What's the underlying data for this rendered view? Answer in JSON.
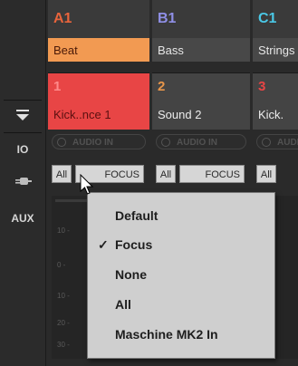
{
  "groups": [
    {
      "letter": "A1",
      "name": "Beat",
      "color": "#e8643c",
      "head_bg": "#f08a4a",
      "name_bg": "#f29a52",
      "name_color": "#4a1a08"
    },
    {
      "letter": "B1",
      "name": "Bass",
      "color": "#8f8fe6"
    },
    {
      "letter": "C1",
      "name": "Strings",
      "color": "#4ac8e6"
    }
  ],
  "sounds": [
    {
      "number": "1",
      "name": "Kick..nce 1",
      "color": "#ff6b6b",
      "bg": "#e84545",
      "name_color": "#5b1010"
    },
    {
      "number": "2",
      "name": "Sound 2",
      "color": "#e8964a"
    },
    {
      "number": "3",
      "name": "Kick.",
      "color": "#e84545"
    }
  ],
  "rail": {
    "io_label": "IO",
    "aux_label": "AUX"
  },
  "audio_in_label": "AUDIO IN",
  "focus_row": {
    "all_label": "All",
    "focus_label": "FOCUS"
  },
  "dropdown": {
    "items": [
      {
        "label": "Default",
        "checked": false
      },
      {
        "label": "Focus",
        "checked": true
      },
      {
        "label": "None",
        "checked": false
      },
      {
        "label": "All",
        "checked": false
      },
      {
        "label": "Maschine MK2 In",
        "checked": false
      }
    ],
    "check_glyph": "✓"
  }
}
